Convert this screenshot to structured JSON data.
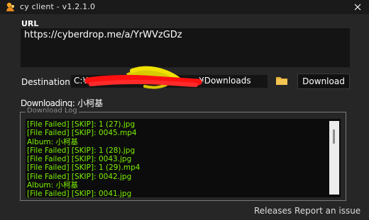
{
  "window": {
    "title": "cy client - v1.2.1.0",
    "app_icon": "cyberdrop-app-icon",
    "close_icon": "close-icon"
  },
  "url": {
    "label": "URL",
    "value": "https://cyberdrop.me/a/YrWVzGDz"
  },
  "destination": {
    "label": "Destination",
    "value_start": "C:¥",
    "value_end": "¥Downloads",
    "redaction_colors": [
      "#ff1a1a",
      "#e0d000"
    ],
    "browse_icon": "folder-icon",
    "download_label": "Download"
  },
  "status": {
    "prefix": "Downloading:",
    "album": "小柯基"
  },
  "log": {
    "legend": "Download Log",
    "text_color": "#7cf000",
    "lines": [
      "[File Failed] [SKIP]: 1 (27).jpg",
      "[File Failed] [SKIP]: 0045.mp4",
      "Album: 小柯基",
      "[File Failed] [SKIP]: 1 (28).jpg",
      "[File Failed] [SKIP]: 0043.jpg",
      "[File Failed] [SKIP]: 1 (29).mp4",
      "[File Failed] [SKIP]: 0042.jpg",
      "Album: 小柯基",
      "[File Failed] [SKIP]: 0041.jpg"
    ]
  },
  "footer": {
    "releases": "Releases",
    "report_issue": "Report an issue"
  }
}
